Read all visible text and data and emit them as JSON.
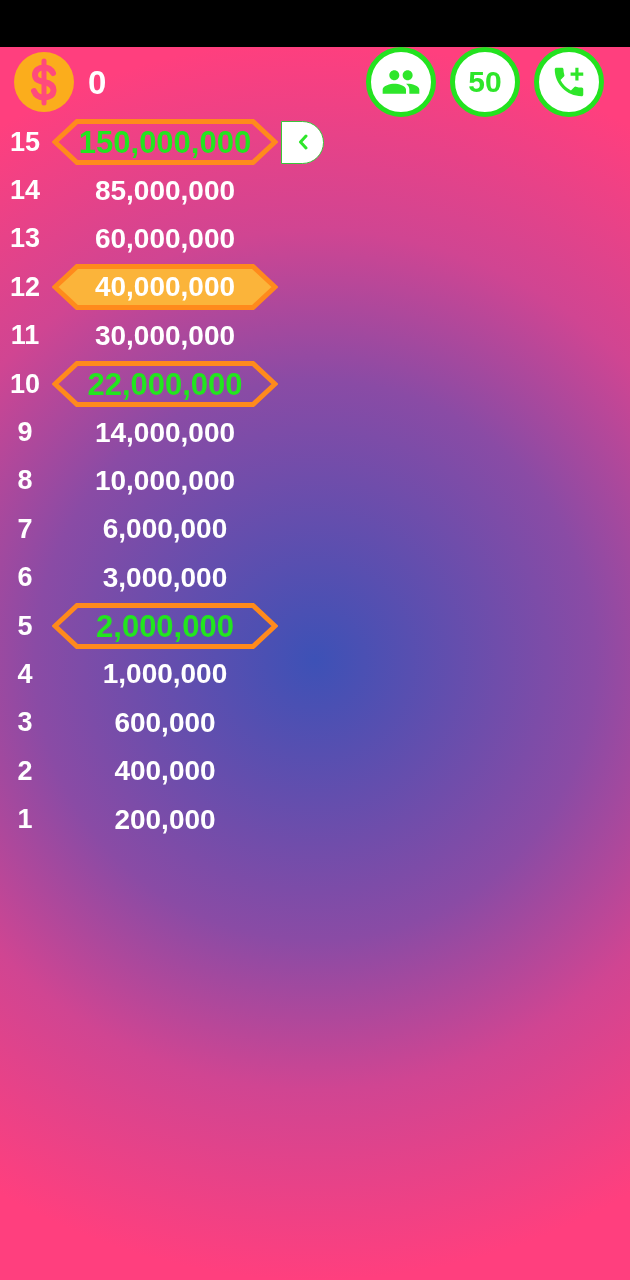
{
  "balance": {
    "amount": "0"
  },
  "lifelines": [
    {
      "kind": "audience"
    },
    {
      "kind": "fifty_fifty",
      "label": "50"
    },
    {
      "kind": "phone"
    }
  ],
  "prize_ladder": {
    "levels": [
      {
        "number": "15",
        "amount": "150,000,000",
        "milestone": true,
        "selected": false
      },
      {
        "number": "14",
        "amount": "85,000,000",
        "milestone": false,
        "selected": false
      },
      {
        "number": "13",
        "amount": "60,000,000",
        "milestone": false,
        "selected": false
      },
      {
        "number": "12",
        "amount": "40,000,000",
        "milestone": false,
        "selected": true
      },
      {
        "number": "11",
        "amount": "30,000,000",
        "milestone": false,
        "selected": false
      },
      {
        "number": "10",
        "amount": "22,000,000",
        "milestone": true,
        "selected": false
      },
      {
        "number": "9",
        "amount": "14,000,000",
        "milestone": false,
        "selected": false
      },
      {
        "number": "8",
        "amount": "10,000,000",
        "milestone": false,
        "selected": false
      },
      {
        "number": "7",
        "amount": "6,000,000",
        "milestone": false,
        "selected": false
      },
      {
        "number": "6",
        "amount": "3,000,000",
        "milestone": false,
        "selected": false
      },
      {
        "number": "5",
        "amount": "2,000,000",
        "milestone": true,
        "selected": false
      },
      {
        "number": "4",
        "amount": "1,000,000",
        "milestone": false,
        "selected": false
      },
      {
        "number": "3",
        "amount": "600,000",
        "milestone": false,
        "selected": false
      },
      {
        "number": "2",
        "amount": "400,000",
        "milestone": false,
        "selected": false
      },
      {
        "number": "1",
        "amount": "200,000",
        "milestone": false,
        "selected": false
      }
    ]
  }
}
